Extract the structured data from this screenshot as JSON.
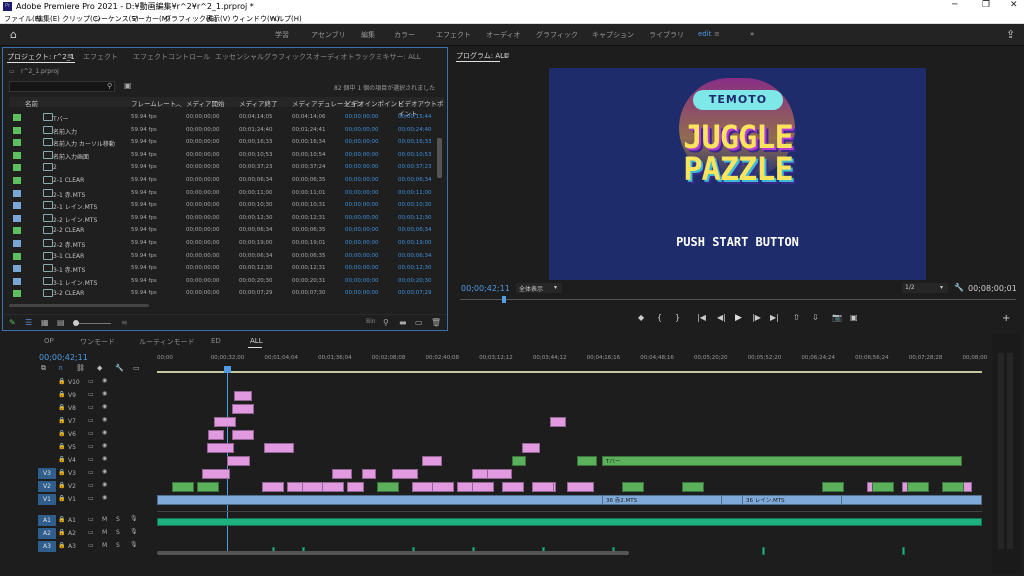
{
  "window": {
    "title": "Adobe Premiere Pro 2021 - D:¥動画編集¥r^2¥r^2_1.prproj *",
    "app_icon": "Pr"
  },
  "menu": [
    "ファイル(F)",
    "編集(E)",
    "クリップ(C)",
    "シーケンス(S)",
    "マーカー(M)",
    "グラフィック(G)",
    "表示(V)",
    "ウィンドウ(W)",
    "ヘルプ(H)"
  ],
  "workspaces": [
    "学習",
    "アセンブリ",
    "編集",
    "カラー",
    "エフェクト",
    "オーディオ",
    "グラフィック",
    "キャプション",
    "ライブラリ",
    "edit"
  ],
  "workspace_active": "edit",
  "project": {
    "tabs": [
      "プロジェクト: r^2_1",
      "エフェクト",
      "エフェクトコントロール",
      "エッセンシャルグラフィックス",
      "オーディオトラックミキサー: ALL"
    ],
    "bin_path": "r^2_1.prproj",
    "search_placeholder": "",
    "selection_info": "82 個中 1 個の項目が選択されました",
    "columns": [
      "名前",
      "フレームレート",
      "メディア開始",
      "メディア終了",
      "メディアデュレーション",
      "ビデオインポイント",
      "ビデオアウトポイント"
    ],
    "rows": [
      {
        "name": "Tバー",
        "rate": "59.94 fps",
        "start": "00;00;00;00",
        "end": "00;04;14;05",
        "dur": "00;04;14;06",
        "vin": "00;00;00;00",
        "vout": "00;00;15;44",
        "color": "#5fbf5f"
      },
      {
        "name": "名前入力",
        "rate": "59.94 fps",
        "start": "00;00;00;00",
        "end": "00;01;24;40",
        "dur": "00;01;24;41",
        "vin": "00;00;00;00",
        "vout": "00;00;24;40",
        "color": "#5fbf5f"
      },
      {
        "name": "名前入力 カーソル移動",
        "rate": "59.94 fps",
        "start": "00;00;00;00",
        "end": "00;00;16;33",
        "dur": "00;00;16;34",
        "vin": "00;00;00;00",
        "vout": "00;00;16;33",
        "color": "#5fbf5f"
      },
      {
        "name": "名前入力画面",
        "rate": "59.94 fps",
        "start": "00;00;00;00",
        "end": "00;00;10;53",
        "dur": "00;00;10;54",
        "vin": "00;00;00;00",
        "vout": "00;00;10;53",
        "color": "#5fbf5f"
      },
      {
        "name": "2",
        "rate": "59.94 fps",
        "start": "00;00;00;00",
        "end": "00;00;37;23",
        "dur": "00;00;37;24",
        "vin": "00;00;00;00",
        "vout": "00;00;37;23",
        "color": "#5fbf5f"
      },
      {
        "name": "2-1 CLEAR",
        "rate": "59.94 fps",
        "start": "00;00;00;00",
        "end": "00;00;06;34",
        "dur": "00;00;06;35",
        "vin": "00;00;00;00",
        "vout": "00;00;06;34",
        "color": "#5fbf5f"
      },
      {
        "name": "2-1 赤.MTS",
        "rate": "59.94 fps",
        "start": "00;00;00;00",
        "end": "00;00;11;00",
        "dur": "00;00;11;01",
        "vin": "00;00;00;00",
        "vout": "00;00;11;00",
        "color": "#7aa6d6"
      },
      {
        "name": "2-1 レイン.MTS",
        "rate": "59.94 fps",
        "start": "00;00;00;00",
        "end": "00;00;10;30",
        "dur": "00;00;10;31",
        "vin": "00;00;00;00",
        "vout": "00;00;10;30",
        "color": "#7aa6d6"
      },
      {
        "name": "2-2 レイン.MTS",
        "rate": "59.94 fps",
        "start": "00;00;00;00",
        "end": "00;00;12;30",
        "dur": "00;00;12;31",
        "vin": "00;00;00;00",
        "vout": "00;00;12;30",
        "color": "#7aa6d6"
      },
      {
        "name": "2-2 CLEAR",
        "rate": "59.94 fps",
        "start": "00;00;00;00",
        "end": "00;00;06;34",
        "dur": "00;00;06;35",
        "vin": "00;00;00;00",
        "vout": "00;00;06;34",
        "color": "#5fbf5f"
      },
      {
        "name": "2-2 赤.MTS",
        "rate": "59.94 fps",
        "start": "00;00;00;00",
        "end": "00;00;19;00",
        "dur": "00;00;19;01",
        "vin": "00;00;00;00",
        "vout": "00;00;19;00",
        "color": "#7aa6d6"
      },
      {
        "name": "3-1 CLEAR",
        "rate": "59.94 fps",
        "start": "00;00;00;00",
        "end": "00;00;06;34",
        "dur": "00;00;06;35",
        "vin": "00;00;00;00",
        "vout": "00;00;06;34",
        "color": "#5fbf5f"
      },
      {
        "name": "3-1 赤.MTS",
        "rate": "59.94 fps",
        "start": "00;00;00;00",
        "end": "00;00;12;30",
        "dur": "00;00;12;31",
        "vin": "00;00;00;00",
        "vout": "00;00;12;30",
        "color": "#7aa6d6"
      },
      {
        "name": "3-1 レイン.MTS",
        "rate": "59.94 fps",
        "start": "00;00;00;00",
        "end": "00;00;20;30",
        "dur": "00;00;20;31",
        "vin": "00;00;00;00",
        "vout": "00;00;20;30",
        "color": "#7aa6d6"
      },
      {
        "name": "3-2 CLEAR",
        "rate": "59.94 fps",
        "start": "00;00;00;00",
        "end": "00;00;07;29",
        "dur": "00;00;07;30",
        "vin": "00;00;00;00",
        "vout": "00;00;07;29",
        "color": "#5fbf5f"
      }
    ],
    "footer_item_count": "Bin"
  },
  "program": {
    "tab": "プログラム: ALL",
    "timecode": "00;00;42;11",
    "fit": "全体表示",
    "resolution": "1/2",
    "duration": "00;08;00;01",
    "frame": {
      "badge": "TEMOTO",
      "title1": "JUGGLE",
      "title2": "PAZZLE",
      "subtitle": "PUSH START BUTTON"
    }
  },
  "timeline": {
    "tabs": [
      "OP",
      "ワンモード",
      "ルーティンモード",
      "ED",
      "ALL"
    ],
    "active_tab": "ALL",
    "timecode": "00;00;42;11",
    "ruler": [
      "00;00",
      "00;00;32;00",
      "00;01;04;04",
      "00;01;36;04",
      "00;02;08;08",
      "00;02;40;08",
      "00;03;12;12",
      "00;03;44;12",
      "00;04;16;16",
      "00;04;48;16",
      "00;05;20;20",
      "00;05;52;20",
      "00;06;24;24",
      "00;06;56;24",
      "00;07;28;28",
      "00;08;00"
    ],
    "video_tracks": [
      "V10",
      "V9",
      "V8",
      "V7",
      "V6",
      "V5",
      "V4",
      "V3",
      "V2",
      "V1"
    ],
    "audio_tracks": [
      "A1",
      "A2",
      "A3"
    ],
    "clip_labels": {
      "t_bar": "Tバー",
      "v1_a": "36 赤2.MTS",
      "v1_b": "36 レイン.MTS"
    }
  }
}
